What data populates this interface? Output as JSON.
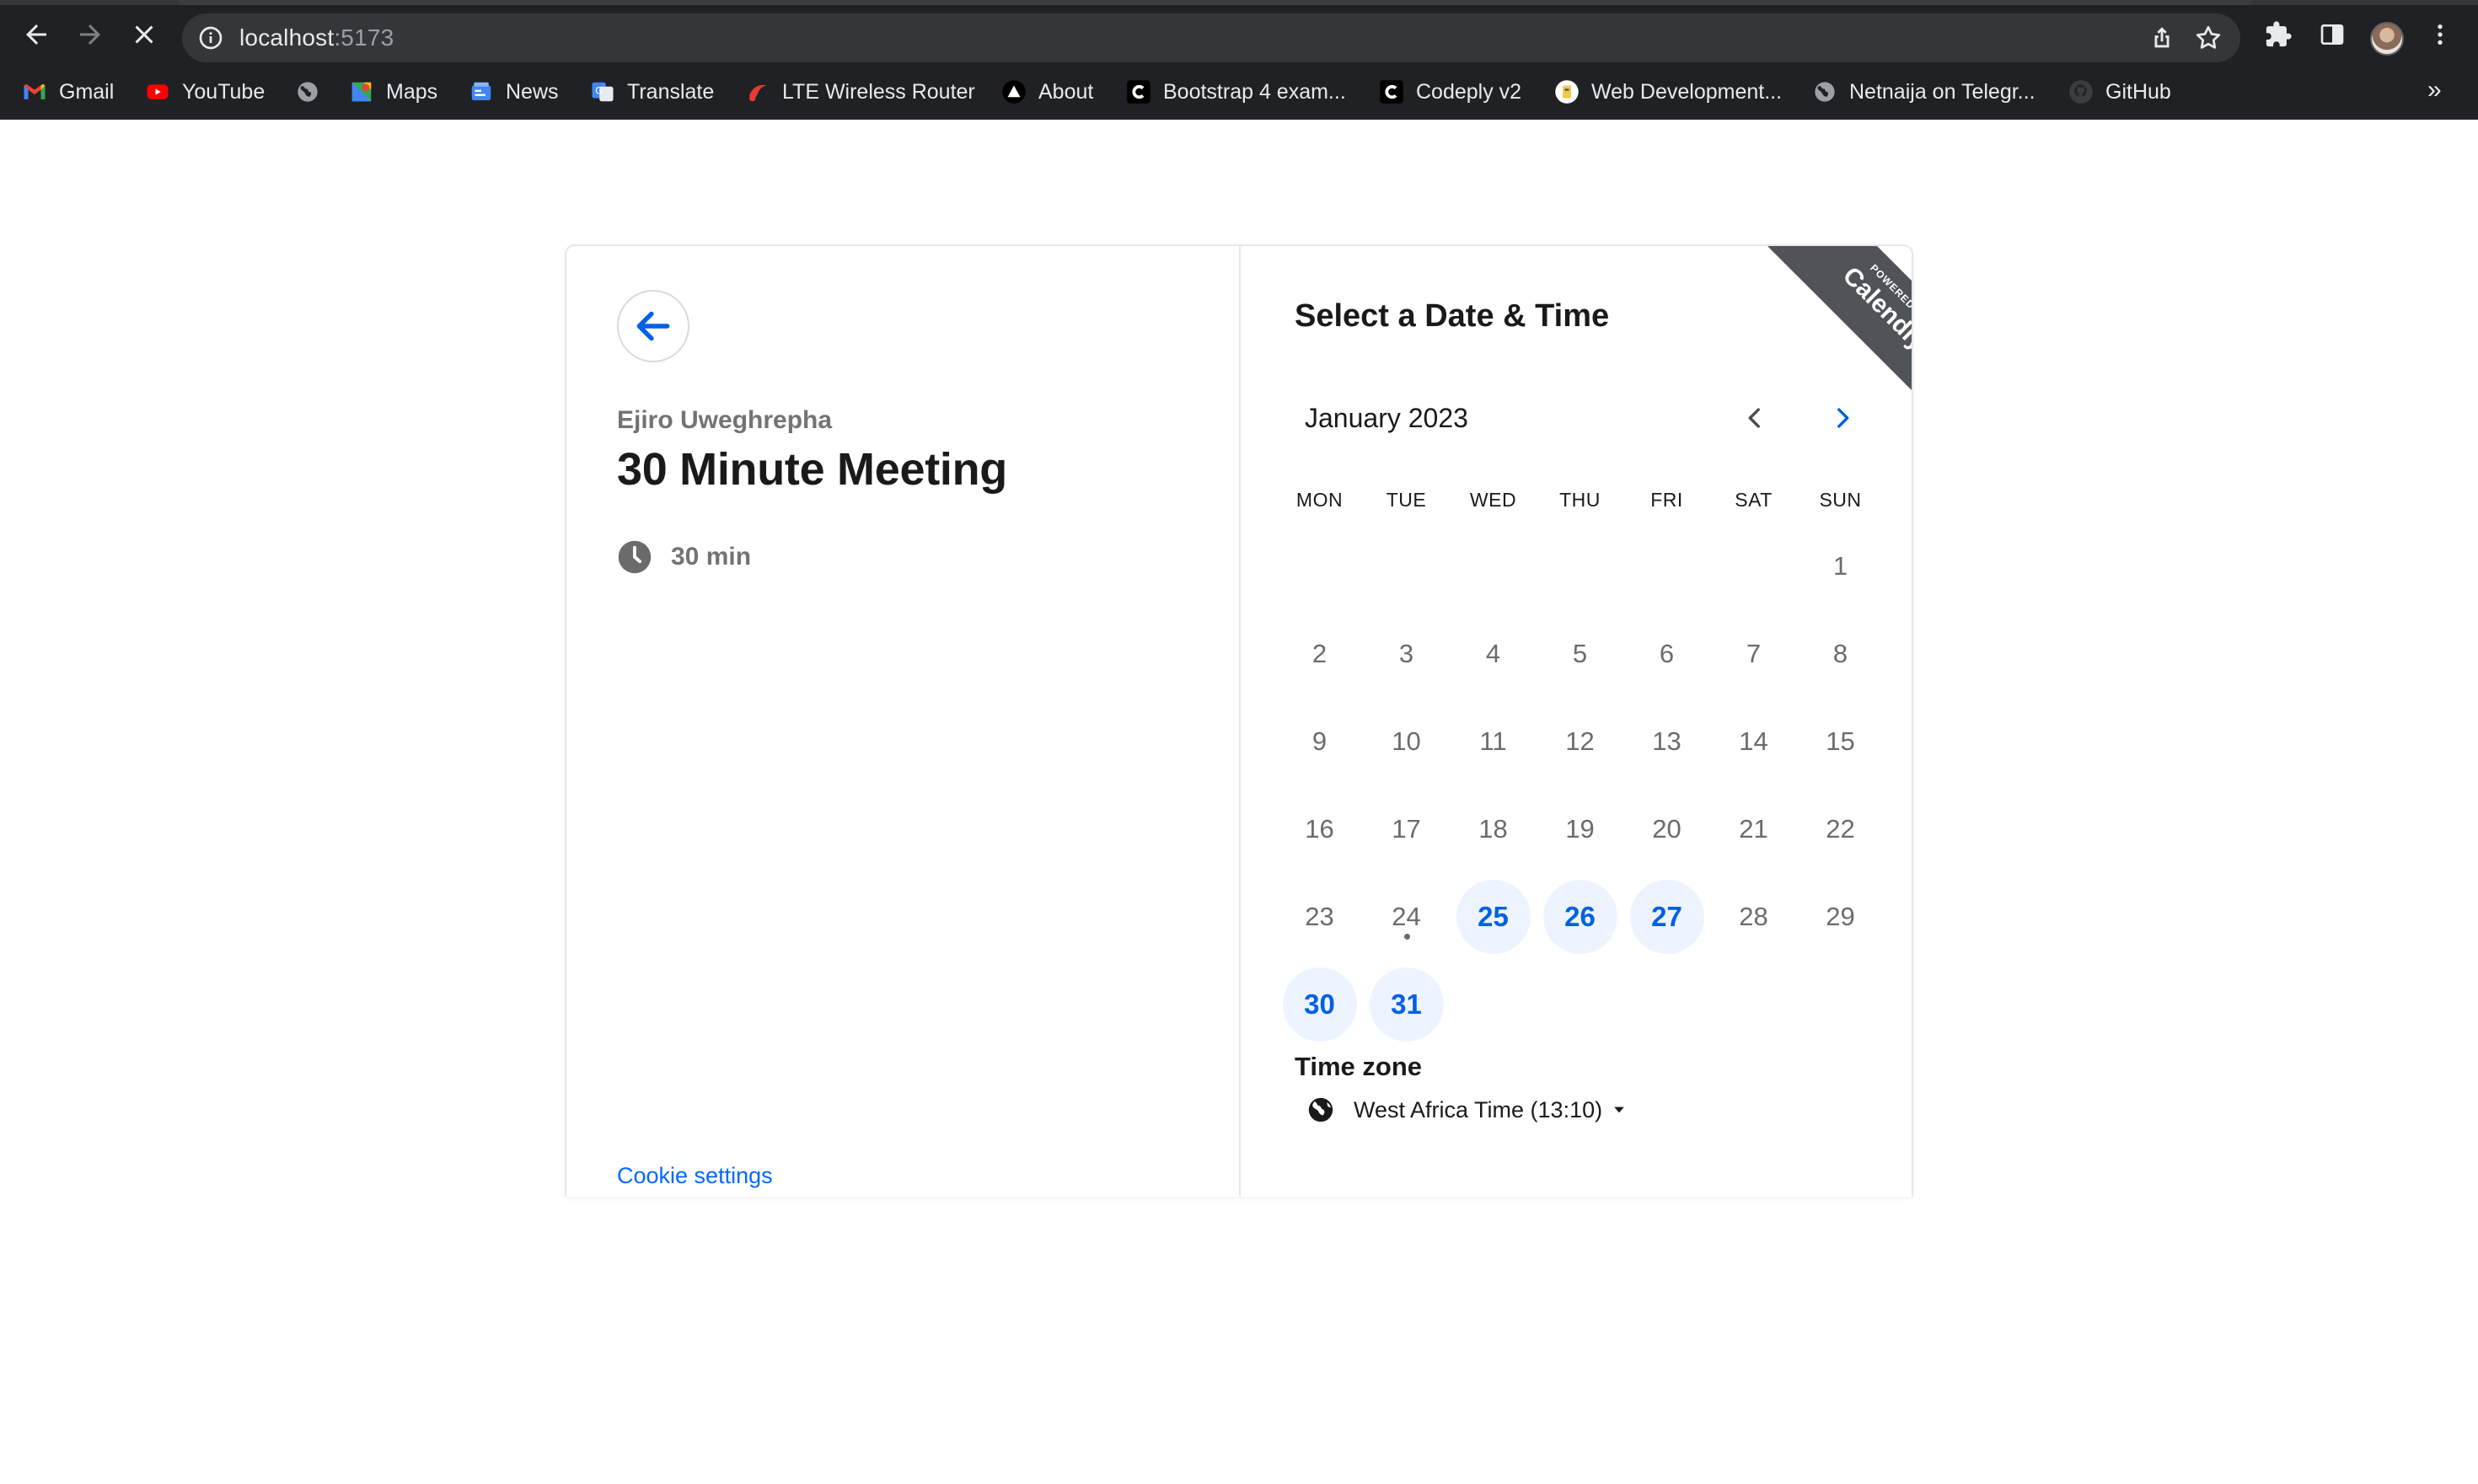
{
  "browser": {
    "url_host": "localhost",
    "url_port": ":5173",
    "bookmarks": [
      {
        "label": "Gmail",
        "icon": "gmail-icon"
      },
      {
        "label": "YouTube",
        "icon": "youtube-icon"
      },
      {
        "label": "",
        "icon": "globe-icon"
      },
      {
        "label": "Maps",
        "icon": "maps-icon"
      },
      {
        "label": "News",
        "icon": "news-icon"
      },
      {
        "label": "Translate",
        "icon": "translate-icon"
      },
      {
        "label": "LTE Wireless Router",
        "icon": "router-icon"
      },
      {
        "label": "About",
        "icon": "about-icon"
      },
      {
        "label": "Bootstrap 4 exam...",
        "icon": "codeply-icon"
      },
      {
        "label": "Codeply v2",
        "icon": "codeply-icon"
      },
      {
        "label": "Web Development...",
        "icon": "webdev-icon"
      },
      {
        "label": "Netnaija on Telegr...",
        "icon": "globe-icon"
      },
      {
        "label": "GitHub",
        "icon": "github-icon"
      }
    ],
    "more_label": "»"
  },
  "event": {
    "organizer": "Ejiro Uweghrepha",
    "title": "30 Minute Meeting",
    "duration": "30 min"
  },
  "footer": {
    "cookie_settings": "Cookie settings"
  },
  "scheduler": {
    "heading": "Select a Date & Time",
    "month": "January 2023",
    "weekdays": [
      "MON",
      "TUE",
      "WED",
      "THU",
      "FRI",
      "SAT",
      "SUN"
    ],
    "leading_blank_days": 6,
    "days_in_month": 31,
    "available_days": [
      25,
      26,
      27,
      30,
      31
    ],
    "today": 24,
    "timezone_label": "Time zone",
    "timezone_value": "West Africa Time (13:10)"
  },
  "badge": {
    "powered_by": "POWERED BY",
    "brand": "Calendly"
  },
  "colors": {
    "accent": "#0060e6",
    "available_bg": "#eef4ff",
    "chrome_bg": "#202124"
  }
}
